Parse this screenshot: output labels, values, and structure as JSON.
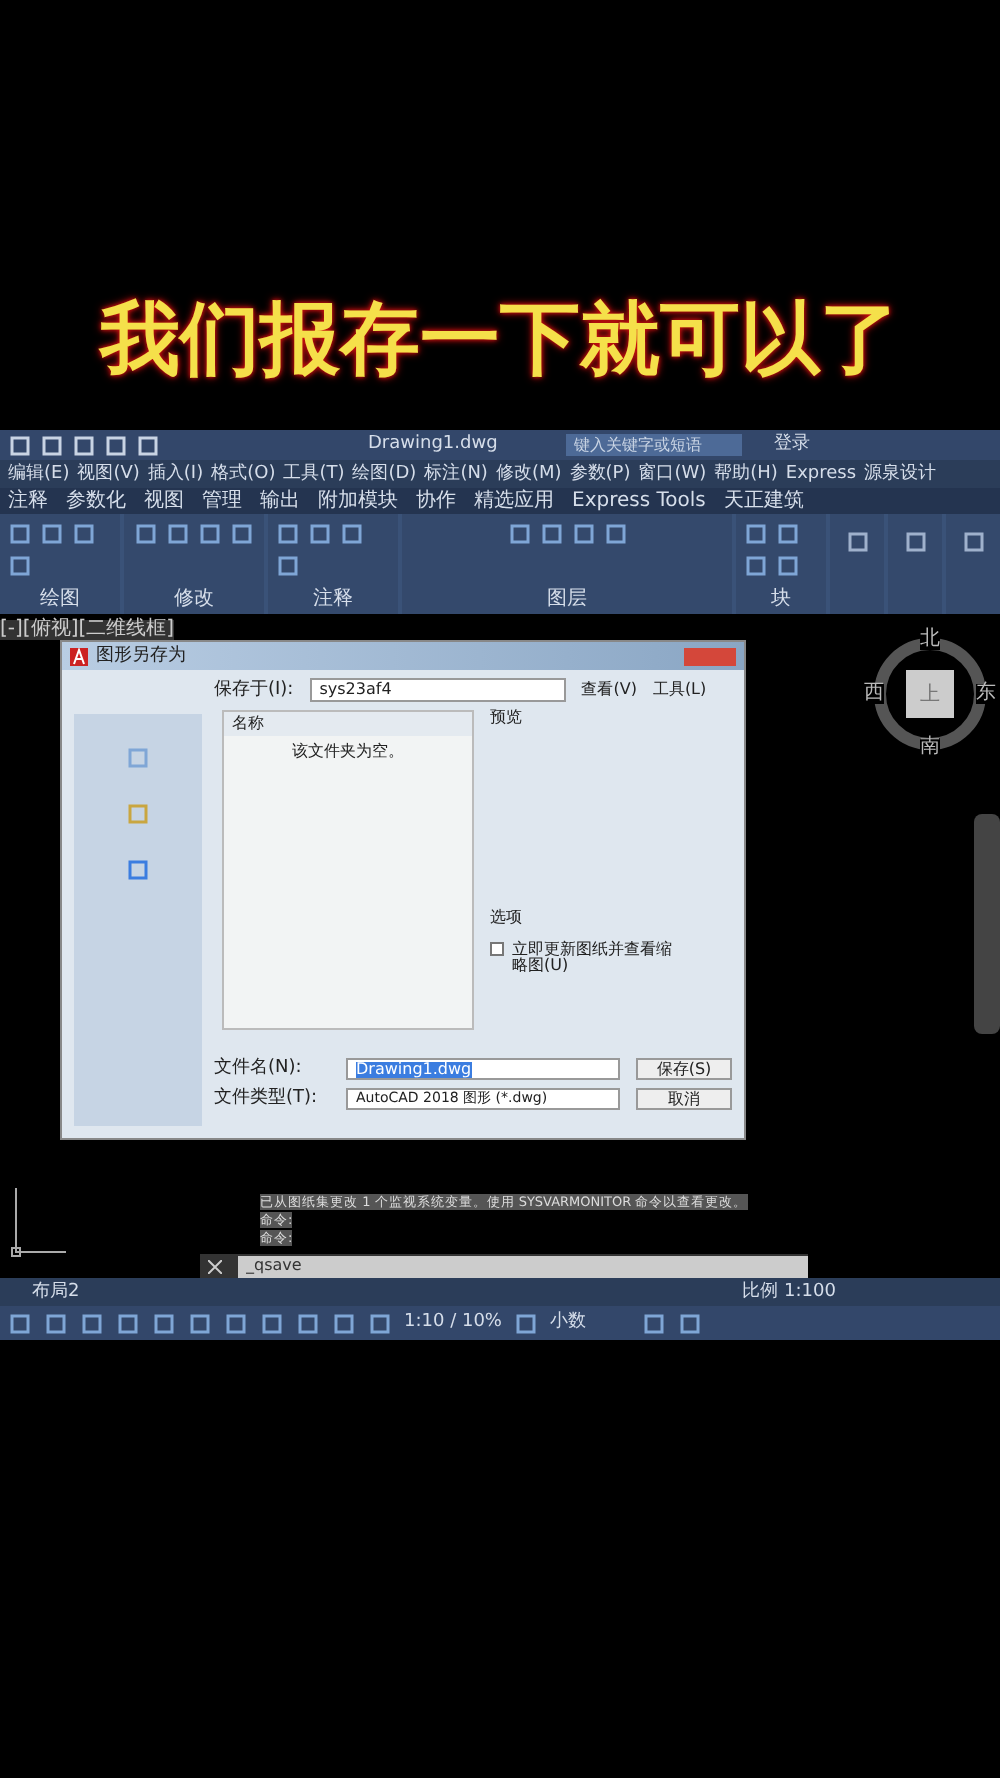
{
  "caption": "我们报存一下就可以了",
  "titlebar": {
    "title": "Drawing1.dwg",
    "search": {
      "placeholder": "键入关键字或短语"
    },
    "login": "登录"
  },
  "menu": [
    "编辑(E)",
    "视图(V)",
    "插入(I)",
    "格式(O)",
    "工具(T)",
    "绘图(D)",
    "标注(N)",
    "修改(M)",
    "参数(P)",
    "窗口(W)",
    "帮助(H)",
    "Express",
    "源泉设计"
  ],
  "ribbon_tabs": [
    "注释",
    "参数化",
    "视图",
    "管理",
    "输出",
    "附加模块",
    "协作",
    "精选应用",
    "Express Tools",
    "天正建筑"
  ],
  "panels": [
    "绘图",
    "修改",
    "注释",
    "图层",
    "块"
  ],
  "viewport_label": "[-][俯视][二维线框]",
  "viewcube": {
    "north": "北",
    "south": "南",
    "east": "东",
    "west": "西",
    "top": "上"
  },
  "dialog": {
    "title": "图形另存为",
    "save_in_label": "保存于(I):",
    "save_in": "sys23af4",
    "toolbar": [
      "查看(V)",
      "工具(L)"
    ],
    "column": "名称",
    "empty": "该文件夹为空。",
    "preview": "预览",
    "options": "选项",
    "update_thumbnail": {
      "label": "立即更新图纸并查看缩略图(U)",
      "checked": false
    },
    "filename_label": "文件名(N):",
    "filename": "Drawing1.dwg",
    "filetype_label": "文件类型(T):",
    "filetype": "AutoCAD 2018 图形 (*.dwg)",
    "buttons": [
      "保存(S)",
      "取消"
    ]
  },
  "command_history": [
    "已从图纸集更改 1 个监视系统变量。使用 SYSVARMONITOR 命令以查看更改。",
    "命令:",
    "命令:"
  ],
  "command_input": "_qsave",
  "layout_tabs": [
    {
      "label": "布局2",
      "selected": false
    }
  ],
  "status": {
    "scale": "比例 1:100",
    "annotation_scale": "1:10 / 10%",
    "units": "小数"
  }
}
